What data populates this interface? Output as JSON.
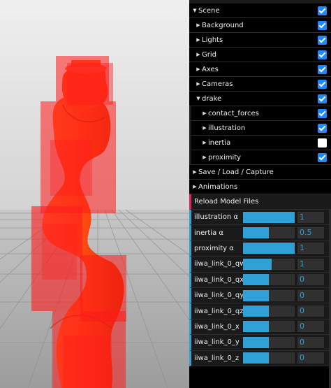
{
  "scene": {
    "label": "Scene",
    "checked": true,
    "children": [
      {
        "label": "Background",
        "checked": true
      },
      {
        "label": "Lights",
        "checked": true
      },
      {
        "label": "Grid",
        "checked": true
      },
      {
        "label": "Axes",
        "checked": true
      },
      {
        "label": "Cameras",
        "checked": true
      }
    ],
    "drake": {
      "label": "drake",
      "checked": true,
      "children": [
        {
          "label": "contact_forces",
          "checked": true
        },
        {
          "label": "illustration",
          "checked": true
        },
        {
          "label": "inertia",
          "checked": false
        },
        {
          "label": "proximity",
          "checked": true
        }
      ]
    }
  },
  "folders": {
    "save_load": "Save / Load / Capture",
    "animations": "Animations"
  },
  "reload_button": "Reload Model Files",
  "sliders": [
    {
      "label": "illustration α",
      "value": "1",
      "fraction": 1.0
    },
    {
      "label": "inertia α",
      "value": "0.5",
      "fraction": 0.5
    },
    {
      "label": "proximity α",
      "value": "1",
      "fraction": 1.0
    },
    {
      "label": "iiwa_link_0_qw",
      "value": "1",
      "fraction": 0.55
    },
    {
      "label": "iiwa_link_0_qx",
      "value": "0",
      "fraction": 0.5
    },
    {
      "label": "iiwa_link_0_qy",
      "value": "0",
      "fraction": 0.5
    },
    {
      "label": "iiwa_link_0_qz",
      "value": "0",
      "fraction": 0.5
    },
    {
      "label": "iiwa_link_0_x",
      "value": "0",
      "fraction": 0.5
    },
    {
      "label": "iiwa_link_0_y",
      "value": "0",
      "fraction": 0.5
    },
    {
      "label": "iiwa_link_0_z",
      "value": "0",
      "fraction": 0.5
    }
  ],
  "colors": {
    "checkbox_on": "#1e88ff",
    "slider_accent": "#2fa1d6",
    "button_accent": "#e61d5f",
    "robot_orange": "#ff4a12",
    "proximity_red": "#ff0000"
  }
}
